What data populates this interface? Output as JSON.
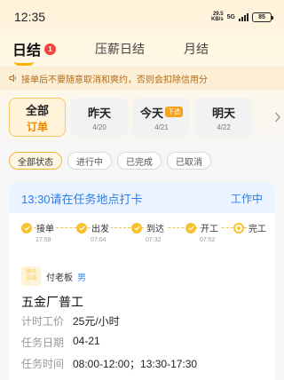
{
  "status_bar": {
    "time": "12:35",
    "net_speed_value": "29.5",
    "net_speed_unit": "KB/s",
    "network": "5G",
    "battery": "85"
  },
  "tabs": [
    {
      "label": "日结",
      "badge": "1",
      "active": true
    },
    {
      "label": "压薪日结",
      "active": false
    },
    {
      "label": "月结",
      "active": false
    }
  ],
  "notice": {
    "icon": "speaker-icon",
    "text": "接单后不要随意取消和爽约，否则会扣除信用分"
  },
  "date_chips": [
    {
      "label": "全部",
      "sub": "订单",
      "active": true
    },
    {
      "label": "昨天",
      "sub": "4/20"
    },
    {
      "label": "今天",
      "tag": "下选",
      "sub": "4/21"
    },
    {
      "label": "明天",
      "sub": "4/22"
    }
  ],
  "filters": [
    {
      "label": "全部状态",
      "active": true
    },
    {
      "label": "进行中"
    },
    {
      "label": "已完成"
    },
    {
      "label": "已取消"
    }
  ],
  "order": {
    "title": "13:30请在任务地点打卡",
    "status": "工作中",
    "steps": [
      {
        "label": "接单",
        "time": "17:59",
        "done": true
      },
      {
        "label": "出发",
        "time": "07:04",
        "done": true
      },
      {
        "label": "到达",
        "time": "07:32",
        "done": true
      },
      {
        "label": "开工",
        "time": "07:52",
        "done": true
      },
      {
        "label": "完工",
        "time": "",
        "done": false
      }
    ],
    "boss_avatar_line1": "快马",
    "boss_avatar_line2": "日结",
    "boss_name": "付老板",
    "boss_gender": "男",
    "job_title": "五金厂普工",
    "rows": [
      {
        "label": "计时工价",
        "value": "25元/小时"
      },
      {
        "label": "任务日期",
        "value": "04-21"
      },
      {
        "label": "任务时间",
        "value": "08:00-12:00；13:30-17:30"
      }
    ]
  },
  "colors": {
    "accent": "#f7b500",
    "notice_text": "#b26b1b",
    "blue": "#2b7ff0",
    "badge": "#f0443c"
  }
}
